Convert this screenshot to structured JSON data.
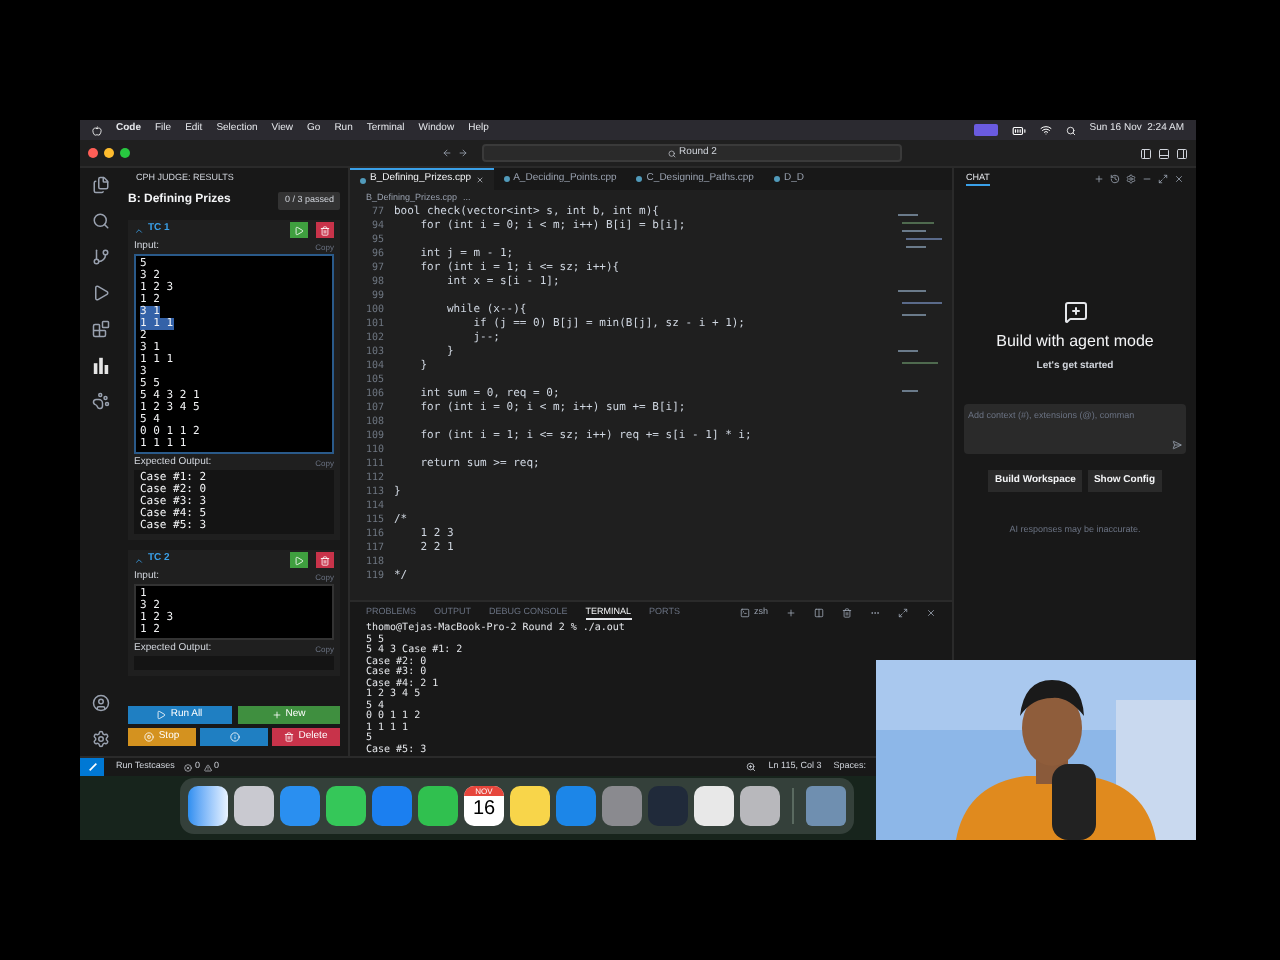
{
  "menu_bar": {
    "app": "Code",
    "items": [
      "File",
      "Edit",
      "Selection",
      "View",
      "Go",
      "Run",
      "Terminal",
      "Window",
      "Help"
    ],
    "clock": "Sun 16 Nov  2:24 AM"
  },
  "title_bar": {
    "search": "Round 2"
  },
  "sidebar": {
    "title": "CPH JUDGE: RESULTS",
    "problem": "B: Defining Prizes",
    "passed": "0 / 3 passed",
    "testcases": [
      {
        "name": "TC 1",
        "expanded": true,
        "input_label": "Input:",
        "input_copy": "Copy",
        "input": [
          {
            "text": "5",
            "selected": false
          },
          {
            "text": "3 2",
            "selected": false
          },
          {
            "text": "1 2 3",
            "selected": false
          },
          {
            "text": "1 2",
            "selected": false
          },
          {
            "text": "3 1",
            "selected": true
          },
          {
            "text": "1 1 1",
            "selected": true
          },
          {
            "text": "2",
            "selected": false
          },
          {
            "text": "3 1",
            "selected": false
          },
          {
            "text": "1 1 1",
            "selected": false
          },
          {
            "text": "3",
            "selected": false
          },
          {
            "text": "5 5",
            "selected": false
          },
          {
            "text": "5 4 3 2 1",
            "selected": false
          },
          {
            "text": "1 2 3 4 5",
            "selected": false
          },
          {
            "text": "5 4",
            "selected": false
          },
          {
            "text": "0 0 1 1 2",
            "selected": false
          },
          {
            "text": "1 1 1 1",
            "selected": false
          }
        ],
        "output_label": "Expected Output:",
        "output_copy": "Copy",
        "output": [
          "Case #1: 2",
          "Case #2: 0",
          "Case #3: 3",
          "Case #4: 5",
          "Case #5: 3"
        ]
      },
      {
        "name": "TC 2",
        "expanded": true,
        "input_label": "Input:",
        "input_copy": "Copy",
        "input": [
          {
            "text": "1",
            "selected": false
          },
          {
            "text": "3 2",
            "selected": false
          },
          {
            "text": "1 2 3",
            "selected": false
          },
          {
            "text": "1 2",
            "selected": false
          }
        ],
        "output_label": "Expected Output:",
        "output_copy": "Copy"
      }
    ],
    "buttons": [
      {
        "kind": "run",
        "label": "Run All"
      },
      {
        "kind": "new",
        "label": "New"
      },
      {
        "kind": "stop",
        "label": "Stop"
      },
      {
        "kind": "info"
      },
      {
        "kind": "delete",
        "label": "Delete"
      }
    ]
  },
  "editor": {
    "tabs": [
      {
        "label": "B_Defining_Prizes.cpp",
        "selected": true
      },
      {
        "label": "A_Deciding_Points.cpp",
        "selected": false
      },
      {
        "label": "C_Designing_Paths.cpp",
        "selected": false
      },
      {
        "label": "D_D",
        "selected": false
      }
    ],
    "breadcrumb": [
      "B_Defining_Prizes.cpp",
      "..."
    ],
    "lines": [
      {
        "n": "77",
        "text": "bool check(vector<int> s, int b, int m){"
      },
      {
        "n": "94",
        "text": "    for (int i = 0; i < m; i++) B[i] = b[i];"
      },
      {
        "n": "95"
      },
      {
        "n": "96",
        "text": "    int j = m - 1;"
      },
      {
        "n": "97",
        "text": "    for (int i = 1; i <= sz; i++){"
      },
      {
        "n": "98",
        "text": "        int x = s[i - 1];"
      },
      {
        "n": "99"
      },
      {
        "n": "100",
        "text": "        while (x--){"
      },
      {
        "n": "101",
        "text": "            if (j == 0) B[j] = min(B[j], sz - i + 1);"
      },
      {
        "n": "102",
        "text": "            j--;"
      },
      {
        "n": "103",
        "text": "        }"
      },
      {
        "n": "104",
        "text": "    }"
      },
      {
        "n": "105"
      },
      {
        "n": "106",
        "text": "    int sum = 0, req = 0;"
      },
      {
        "n": "107",
        "text": "    for (int i = 0; i < m; i++) sum += B[i];"
      },
      {
        "n": "108"
      },
      {
        "n": "109",
        "text": "    for (int i = 1; i <= sz; i++) req += s[i - 1] * i;"
      },
      {
        "n": "110"
      },
      {
        "n": "111",
        "text": "    return sum >= req;"
      },
      {
        "n": "112"
      },
      {
        "n": "113",
        "text": "}"
      },
      {
        "n": "114"
      },
      {
        "n": "115",
        "text": "/*"
      },
      {
        "n": "116",
        "text": "    1 2 3"
      },
      {
        "n": "117",
        "text": "    2 2 1"
      },
      {
        "n": "118"
      },
      {
        "n": "119",
        "text": "*/"
      }
    ]
  },
  "panel": {
    "tabs": [
      {
        "label": "PROBLEMS",
        "selected": false
      },
      {
        "label": "OUTPUT",
        "selected": false
      },
      {
        "label": "DEBUG CONSOLE",
        "selected": false
      },
      {
        "label": "TERMINAL",
        "selected": true
      },
      {
        "label": "PORTS",
        "selected": false
      }
    ],
    "shell": "zsh",
    "lines": [
      "thomo@Tejas-MacBook-Pro-2 Round 2 % ./a.out",
      "5 5",
      "5 4 3 Case #1: 2",
      "Case #2: 0",
      "Case #3: 0",
      "Case #4: 2 1",
      "1 2 3 4 5",
      "5 4",
      "0 0 1 1 2",
      "1 1 1 1",
      "5",
      "Case #5: 3"
    ]
  },
  "chat": {
    "tab": "CHAT",
    "heading": "Build with agent mode",
    "subheading": "Let's get started",
    "input": {
      "placeholder": "Add context (#), extensions (@), comman"
    },
    "buttons": [
      "Build Workspace",
      "Show Config"
    ],
    "note": "AI responses may be inaccurate."
  },
  "status_bar": {
    "task": "Run Testcases",
    "errors": "0",
    "warnings": "0",
    "position": "Ln 115, Col 3",
    "spaces": "Spaces:"
  },
  "dock": {
    "month": "NOV",
    "day": "16"
  }
}
